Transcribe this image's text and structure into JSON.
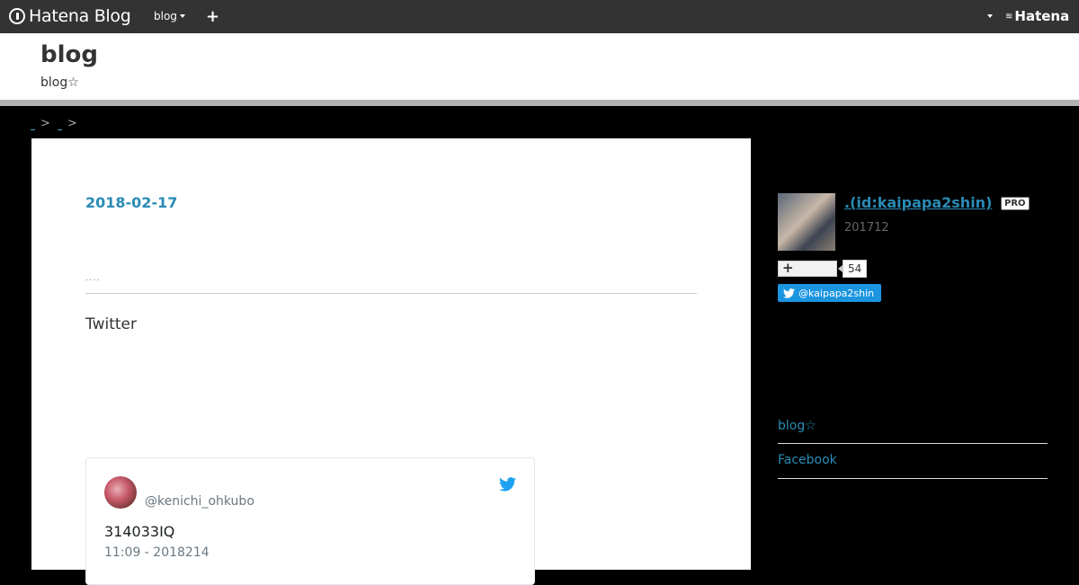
{
  "topbar": {
    "brand": "Hatena Blog",
    "blog_menu": "blog",
    "plus": "+",
    "hatena": "Hatena"
  },
  "header": {
    "title": "blog",
    "description": "blog☆"
  },
  "breadcrumb": {
    "separators": [
      ">",
      ">"
    ]
  },
  "entry": {
    "date": "2018-02-17",
    "dots": "....",
    "twitter_label": "Twitter"
  },
  "tweet": {
    "handle": "@kenichi_ohkubo",
    "text": "314033IQ",
    "time": "11:09 - 2018214"
  },
  "profile": {
    "name": ".(id:kaipapa2shin)",
    "badge": "PRO",
    "since": "201712",
    "follow_count": "54",
    "twitter_follow": "@kaipapa2shin"
  },
  "sidebar_links": [
    {
      "label": "blog☆"
    },
    {
      "label": "Facebook"
    }
  ],
  "colors": {
    "topbar": "#333333",
    "link": "#2a8bb5",
    "twitter": "#1b95e0",
    "background": "#000000"
  }
}
